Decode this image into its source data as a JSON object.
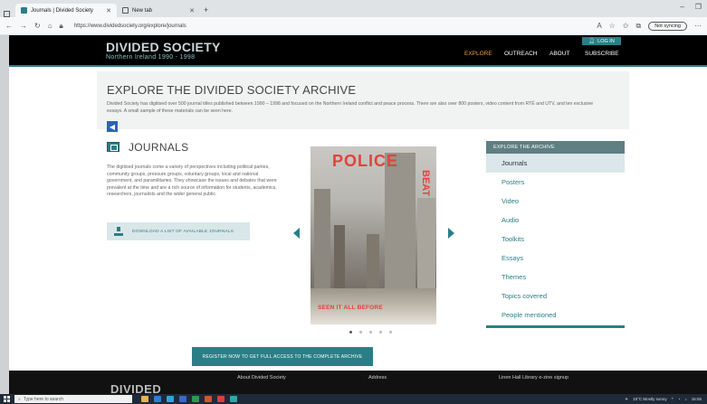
{
  "browser": {
    "tabs": [
      {
        "title": "Journals | Divided Society",
        "active": true
      },
      {
        "title": "New tab",
        "active": false
      }
    ],
    "url": "https://www.dividedsociety.org/explore/journals",
    "sync_label": "Not syncing"
  },
  "header": {
    "logo_title": "DIVIDED SOCIETY",
    "logo_subtitle": "Northern Ireland 1990 - 1998",
    "login_label": "LOG IN",
    "nav": [
      "EXPLORE",
      "OUTREACH",
      "ABOUT",
      "SUBSCRIBE"
    ]
  },
  "intro": {
    "title": "EXPLORE THE DIVIDED SOCIETY ARCHIVE",
    "text": "Divided Society has digitised over 500 journal titles published between 1990 – 1998 and focused on the Northern Ireland conflict and peace process. There are also over 800 posters, video content from RTÉ and UTV, and ten exclusive essays. A small sample of these materials can be seen here."
  },
  "journals": {
    "title": "JOURNALS",
    "text": "The digitised journals come a variety of perspectives including political parties, community groups, pressure groups, voluntary groups, local and national government, and paramilitaries. They showcase the issues and debates that were prevalent at the time and are a rich source of information for students, academics, researchers, journalists and the wider general public.",
    "download_label": "DOWNLOAD A LIST OF AVAILABLE JOURNALS"
  },
  "cover": {
    "title_a": "POLICE",
    "title_b": "BEAT",
    "tagline": "SEEN IT ALL BEFORE"
  },
  "carousel": {
    "slides": 5,
    "active_index": 0
  },
  "explore": {
    "heading": "EXPLORE THE ARCHIVE",
    "items": [
      "Journals",
      "Posters",
      "Video",
      "Audio",
      "Toolkits",
      "Essays",
      "Themes",
      "Topics covered",
      "People mentioned"
    ],
    "active_index": 0
  },
  "register_label": "REGISTER NOW TO GET FULL ACCESS TO THE COMPLETE ARCHIVE",
  "footer": {
    "logo": "DIVIDED",
    "columns": [
      "About Divided Society",
      "Address",
      "Linen Hall Library e-zine signup"
    ]
  },
  "taskbar": {
    "search_placeholder": "Type here to search",
    "weather": "15°C  Mostly sunny",
    "time": "16:55"
  },
  "colors": {
    "accent": "#2a7f86",
    "header_bg": "#000000",
    "cover_red": "#e0433b"
  }
}
